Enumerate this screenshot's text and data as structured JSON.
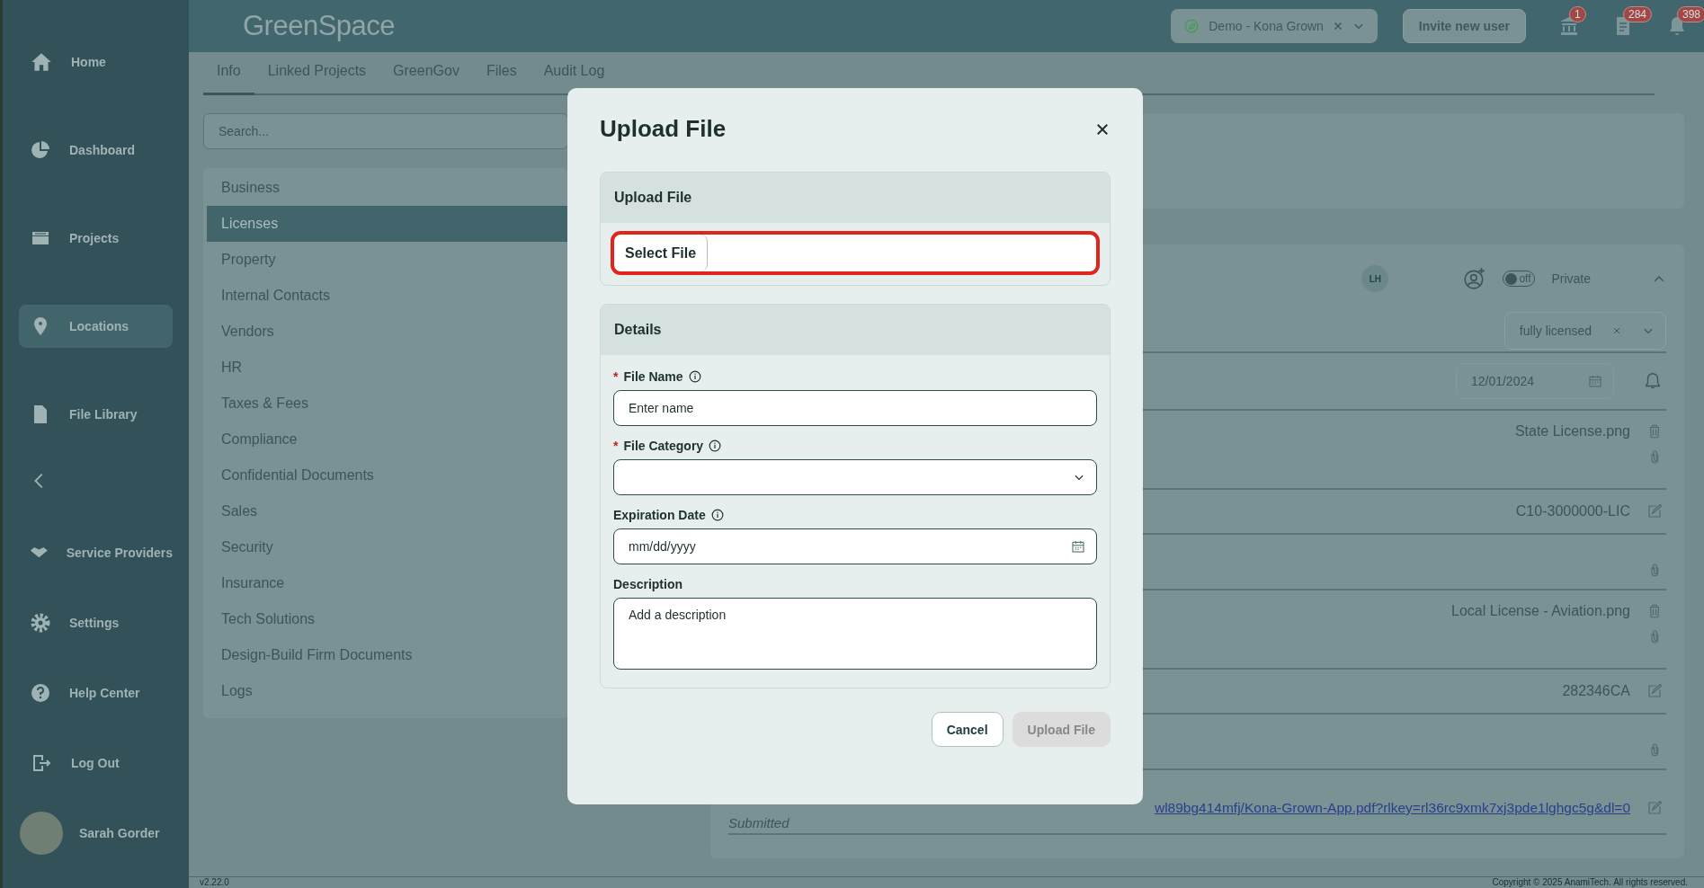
{
  "sidebar": {
    "items": [
      {
        "kind": "nav",
        "label": "Home",
        "selected": false
      },
      {
        "kind": "nav",
        "label": "Dashboard",
        "selected": false
      },
      {
        "kind": "nav",
        "label": "Projects",
        "selected": false
      },
      {
        "kind": "nav",
        "label": "Locations",
        "selected": true
      },
      {
        "kind": "nav",
        "label": "File Library",
        "selected": false
      },
      {
        "kind": "collapse",
        "selected": false
      },
      {
        "kind": "nav",
        "label": "Service Providers",
        "selected": false
      },
      {
        "kind": "nav",
        "label": "Settings",
        "selected": false
      },
      {
        "kind": "nav",
        "label": "Help Center",
        "selected": false
      },
      {
        "kind": "nav",
        "label": "Log Out",
        "selected": false
      }
    ],
    "user": {
      "name": "Sarah Gorder"
    }
  },
  "header": {
    "logo": "GreenSpace",
    "org_selector": {
      "value": "Demo - Kona Grown"
    },
    "invite_button": "Invite new user",
    "notifications": [
      {
        "count": "1"
      },
      {
        "count": "284"
      },
      {
        "count": "398"
      }
    ]
  },
  "tabs": [
    {
      "label": "Info",
      "selected": true
    },
    {
      "label": "Linked Projects",
      "selected": false
    },
    {
      "label": "GreenGov",
      "selected": false
    },
    {
      "label": "Files",
      "selected": false
    },
    {
      "label": "Audit Log",
      "selected": false
    }
  ],
  "search": {
    "placeholder": "Search..."
  },
  "categories": [
    {
      "label": "Business",
      "selected": false
    },
    {
      "label": "Licenses",
      "selected": true
    },
    {
      "label": "Property",
      "selected": false
    },
    {
      "label": "Internal Contacts",
      "selected": false
    },
    {
      "label": "Vendors",
      "selected": false
    },
    {
      "label": "HR",
      "selected": false
    },
    {
      "label": "Taxes & Fees",
      "selected": false
    },
    {
      "label": "Compliance",
      "selected": false
    },
    {
      "label": "Confidential Documents",
      "selected": false
    },
    {
      "label": "Sales",
      "selected": false
    },
    {
      "label": "Security",
      "selected": false
    },
    {
      "label": "Insurance",
      "selected": false
    },
    {
      "label": "Tech Solutions",
      "selected": false
    },
    {
      "label": "Design-Build Firm Documents",
      "selected": false
    },
    {
      "label": "Logs",
      "selected": false
    }
  ],
  "license_card": {
    "avatar": "LH",
    "private_toggle": {
      "on": false,
      "state_label": "off",
      "label": "Private"
    },
    "expanded": true,
    "status": "fully licensed",
    "rows": [
      {
        "kind": "date",
        "value": "12/01/2024"
      },
      {
        "kind": "file",
        "value": "State License.png"
      },
      {
        "kind": "text",
        "value": "C10-3000000-LIC"
      },
      {
        "kind": "attach"
      },
      {
        "kind": "file",
        "value": "Local License - Aviation.png"
      },
      {
        "kind": "text",
        "value": "282346CA"
      },
      {
        "kind": "attach"
      },
      {
        "kind": "link",
        "value": "wl89bg414mfj/Kona-Grown-App.pdf?rlkey=rl36rc9xmk7xj3pde1lghgc5g&dl=0",
        "note": "Submitted"
      }
    ]
  },
  "footer": {
    "version": "v2.22.0",
    "copyright": "Copyright © 2025 AnamiTech. All rights reserved."
  },
  "modal": {
    "title": "Upload File",
    "upload_section": {
      "title": "Upload File",
      "select_button": "Select File",
      "highlighted": true
    },
    "details_section": {
      "title": "Details",
      "fields": [
        {
          "kind": "text",
          "required_mark": "*",
          "label": "File Name",
          "info": true,
          "placeholder": "Enter name"
        },
        {
          "kind": "select",
          "required_mark": "*",
          "label": "File Category",
          "info": true
        },
        {
          "kind": "date",
          "label": "Expiration Date",
          "info": true,
          "placeholder": "mm/dd/yyyy"
        },
        {
          "kind": "textarea",
          "label": "Description",
          "info": false,
          "placeholder": "Add a description"
        }
      ]
    },
    "buttons": [
      {
        "label": "Cancel",
        "disabled": false
      },
      {
        "label": "Upload File",
        "disabled": true
      }
    ]
  }
}
